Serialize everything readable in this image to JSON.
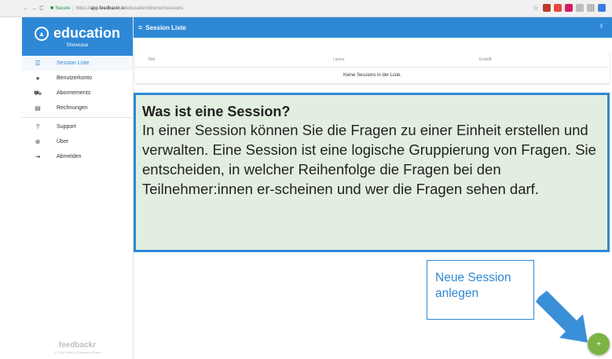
{
  "browser": {
    "secure_label": "Secure",
    "url_protocol": "https://",
    "url_host": "app.feedbackr.io",
    "url_path": "/education/director/sessions"
  },
  "sidebar": {
    "brand_title": "education",
    "brand_subtitle": "Showcase",
    "items": [
      {
        "label": "Session Liste",
        "icon": "list-icon",
        "glyph": "☰"
      },
      {
        "label": "Benutzerkonto",
        "icon": "person-icon",
        "glyph": "●"
      },
      {
        "label": "Abonnements",
        "icon": "cart-icon",
        "glyph": "⛟"
      },
      {
        "label": "Rechnungen",
        "icon": "invoice-icon",
        "glyph": "▤"
      },
      {
        "label": "Support",
        "icon": "help-icon",
        "glyph": "?"
      },
      {
        "label": "Über",
        "icon": "globe-icon",
        "glyph": "⊕"
      },
      {
        "label": "Abmelden",
        "icon": "logout-icon",
        "glyph": "⇥"
      }
    ],
    "footer_logo": "feedbackr",
    "footer_copy": "© 2018 Gerrit & Company GmbH"
  },
  "topbar": {
    "title": "Session Liste"
  },
  "table": {
    "headers": [
      "Titel",
      "Lizenz",
      "Erstellt"
    ],
    "empty_message": "Keine Sessions in der Liste."
  },
  "info": {
    "title": "Was ist eine Session?",
    "body": "In einer Session können Sie die Fragen zu einer Einheit erstellen und verwalten. Eine Session ist eine logische Gruppierung von Fragen. Sie entscheiden, in welcher Reihenfolge die Fragen bei den Teilnehmer:innen er-scheinen und wer die Fragen sehen darf."
  },
  "action_callout": {
    "text": "Neue Session anlegen"
  },
  "fab": {
    "label": "+"
  },
  "colors": {
    "primary": "#2e88d6",
    "callout_bg": "#e2eedf",
    "fab": "#7cb342"
  }
}
